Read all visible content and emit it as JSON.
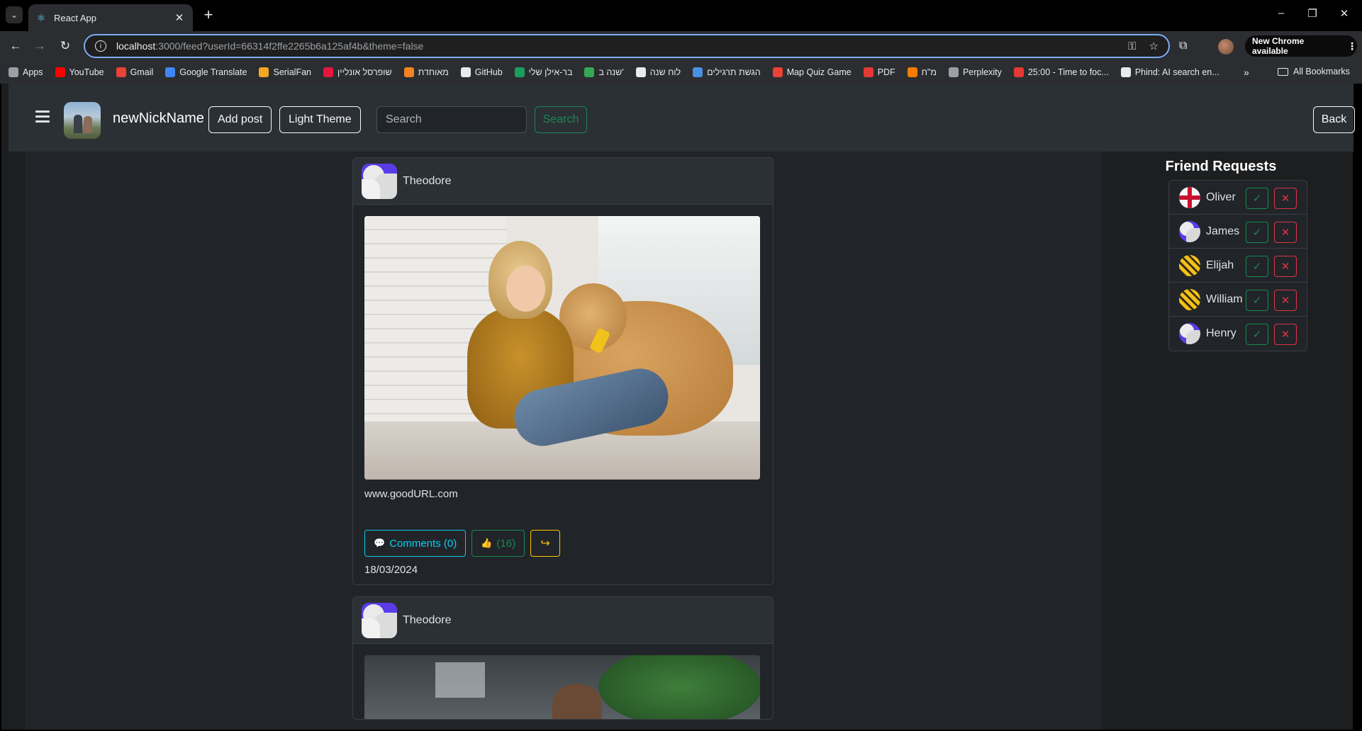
{
  "browser": {
    "tab_title": "React App",
    "url_host": "localhost",
    "url_rest": ":3000/feed?userId=66314f2ffe2265b6a125af4b&theme=false",
    "new_chrome": "New Chrome available",
    "bookmarks": [
      {
        "label": "Apps",
        "icon": "apps-grid-icon",
        "color": "#9aa0a6"
      },
      {
        "label": "YouTube",
        "icon": "youtube-icon",
        "color": "#ff0000"
      },
      {
        "label": "Gmail",
        "icon": "gmail-icon",
        "color": "#ea4335"
      },
      {
        "label": "Google Translate",
        "icon": "translate-icon",
        "color": "#4285f4"
      },
      {
        "label": "SerialFan",
        "icon": "serialfan-icon",
        "color": "#f5a623"
      },
      {
        "label": "שופרסל אונליין",
        "icon": "shufersal-icon",
        "color": "#e5173f"
      },
      {
        "label": "מאוחדת",
        "icon": "meuhedet-icon",
        "color": "#f58220"
      },
      {
        "label": "GitHub",
        "icon": "github-icon",
        "color": "#e8eaed"
      },
      {
        "label": "בר-אילן שלי",
        "icon": "biu-icon",
        "color": "#1a9e5c"
      },
      {
        "label": "שנה ב'",
        "icon": "drive-icon",
        "color": "#34a853"
      },
      {
        "label": "לוח שנה",
        "icon": "calendar-icon",
        "color": "#e8eaed"
      },
      {
        "label": "הגשת תרגילים",
        "icon": "upload-icon",
        "color": "#4a90e2"
      },
      {
        "label": "Map Quiz Game",
        "icon": "map-pin-icon",
        "color": "#ea4335"
      },
      {
        "label": "PDF",
        "icon": "pdf-heart-icon",
        "color": "#e53935"
      },
      {
        "label": "מ\"ח",
        "icon": "mh-icon",
        "color": "#f57c00"
      },
      {
        "label": "Perplexity",
        "icon": "perplexity-icon",
        "color": "#9aa0a6"
      },
      {
        "label": "25:00 - Time to foc...",
        "icon": "pomodoro-icon",
        "color": "#e53935"
      },
      {
        "label": "Phind: AI search en...",
        "icon": "phind-icon",
        "color": "#e8eaed"
      }
    ],
    "all_bookmarks": "All Bookmarks"
  },
  "nav": {
    "username": "newNickName",
    "add_post": "Add post",
    "theme_toggle": "Light Theme",
    "search_placeholder": "Search",
    "search_button": "Search",
    "back": "Back"
  },
  "posts": [
    {
      "author": "Theodore",
      "text": "www.goodURL.com",
      "comments": "Comments (0)",
      "likes": "(16)",
      "date": "18/03/2024"
    },
    {
      "author": "Theodore"
    }
  ],
  "friend_requests": {
    "title": "Friend Requests",
    "items": [
      {
        "name": "Oliver",
        "avatar": "flag"
      },
      {
        "name": "James",
        "avatar": "swirl"
      },
      {
        "name": "Elijah",
        "avatar": "bees"
      },
      {
        "name": "William",
        "avatar": "bees"
      },
      {
        "name": "Henry",
        "avatar": "swirl"
      }
    ]
  }
}
